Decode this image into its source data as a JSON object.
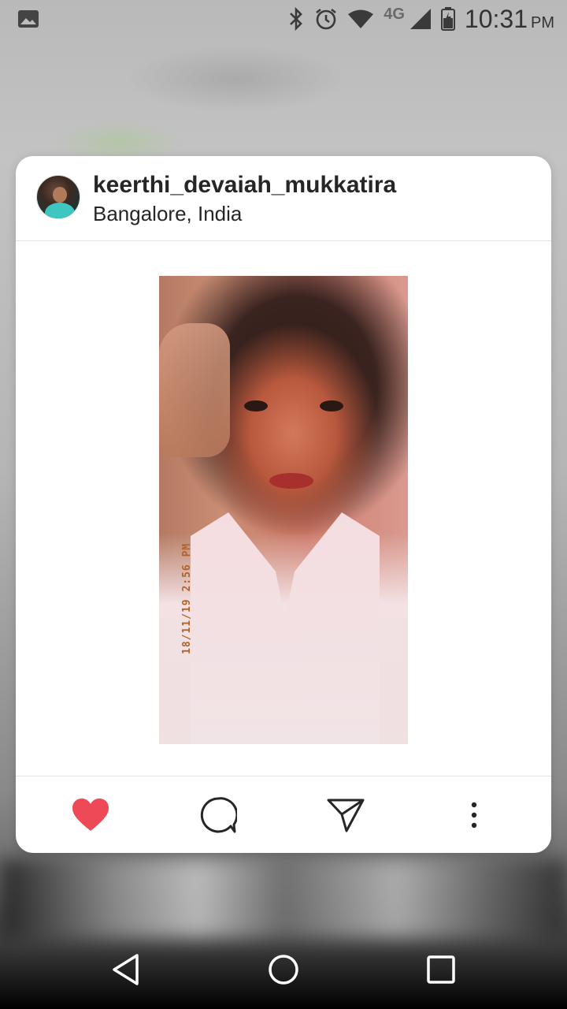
{
  "status_bar": {
    "network_label": "4G",
    "time": "10:31",
    "ampm": "PM",
    "icons": [
      "image-icon",
      "bluetooth-icon",
      "alarm-icon",
      "wifi-icon",
      "signal-icon",
      "battery-icon"
    ]
  },
  "post": {
    "username": "keerthi_devaiah_mukkatira",
    "location": "Bangalore, India",
    "photo_timestamp": "18/11/19 2:56 PM",
    "actions": [
      "like-icon",
      "comment-icon",
      "share-icon",
      "more-icon"
    ]
  },
  "colors": {
    "like": "#ed4956",
    "text": "#262626"
  },
  "nav_bar": {
    "buttons": [
      "back",
      "home",
      "recents"
    ]
  }
}
